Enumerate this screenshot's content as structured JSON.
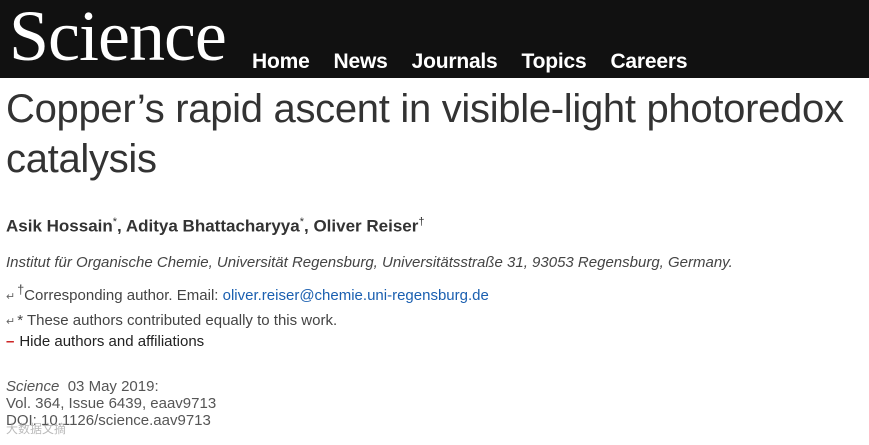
{
  "header": {
    "logo": "Science",
    "nav": [
      "Home",
      "News",
      "Journals",
      "Topics",
      "Careers"
    ]
  },
  "article": {
    "title": "Copper’s rapid ascent in visible-light photoredox catalysis",
    "authors": [
      {
        "name": "Asik Hossain",
        "mark": "*"
      },
      {
        "name": "Aditya Bhattacharyya",
        "mark": "*"
      },
      {
        "name": "Oliver Reiser",
        "mark": "†"
      }
    ],
    "affiliation": "Institut für Organische Chemie, Universität Regensburg, Universitätsstraße 31, 93053 Regensburg, Germany.",
    "corresponding_mark": "†",
    "corresponding_text": "Corresponding author. Email: ",
    "email": "oliver.reiser@chemie.uni-regensburg.de",
    "equal_contrib": "* These authors contributed equally to this work.",
    "hide_toggle": "Hide authors and affiliations",
    "journal": "Science",
    "date": "03 May 2019:",
    "volume_issue": "Vol. 364, Issue 6439, eaav9713",
    "doi": "DOI: 10.1126/science.aav9713"
  },
  "watermark": "大数据文摘"
}
